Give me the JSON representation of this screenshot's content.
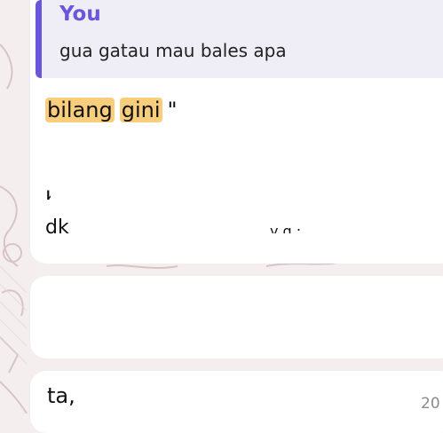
{
  "reply": {
    "author": "You",
    "text": "gua gatau mau bales apa"
  },
  "message": {
    "highlight_1": "bilang",
    "highlight_2": "gini",
    "after": "\"",
    "fragment_a": "h",
    "fragment_b": "dk",
    "fragment_c": "y g ;",
    "fragment_d": ".",
    "last_fragment": "ta,"
  },
  "timestamp": "20",
  "colors": {
    "accent": "#6a56d8",
    "highlight": "#f8cd7b",
    "bubble": "#ffffff",
    "background": "#f4efee"
  }
}
